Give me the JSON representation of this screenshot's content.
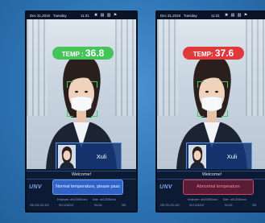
{
  "devices": [
    {
      "status": {
        "date": "Dec 31,2019",
        "day": "Tuesday",
        "time": "11:31",
        "icons": "✖ ▤ ▥ ⚑"
      },
      "temp_label": "TEMP : ",
      "temp_value": "36.8",
      "temp_state": "normal",
      "person_name": "Xuli",
      "welcome": "Welcome!",
      "logo": "UNV",
      "message": "Normal temperature, please pass",
      "info_row1": [
        "",
        "Employee: ab123456/xxxx",
        "Date : ab12345/xxxx",
        ""
      ],
      "info_row2": [
        "200.201.201.222",
        "90.212/42/47",
        "90.241",
        "392"
      ]
    },
    {
      "status": {
        "date": "Dec 31,2019",
        "day": "Tuesday",
        "time": "11:31",
        "icons": "✖ ▤ ▥ ⚑"
      },
      "temp_label": "TEMP: ",
      "temp_value": "37.6",
      "temp_state": "abnormal",
      "person_name": "Xuli",
      "welcome": "Welcome!",
      "logo": "UNV",
      "message": "Abnormal temperature",
      "info_row1": [
        "",
        "Employee: ab123456/xxxx",
        "Date : ab12345/xxxx",
        ""
      ],
      "info_row2": [
        "200.201.201.222",
        "90.212/42/47",
        "90.241",
        "392"
      ]
    }
  ],
  "colors": {
    "background": "#2f78b8",
    "normal_pill": "#46c35a",
    "abnormal_pill": "#e0393b",
    "face_frame": "#3ccf5a",
    "normal_message": "#2f63c8",
    "abnormal_message": "#5a1d35"
  }
}
